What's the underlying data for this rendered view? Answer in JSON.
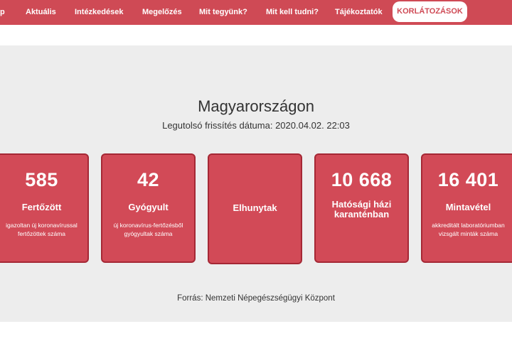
{
  "nav": {
    "items": [
      "p",
      "Aktuális",
      "Intézkedések",
      "Megelőzés",
      "Mit tegyünk?",
      "Mit kell tudni?",
      "Tájékoztatók"
    ],
    "highlight": "KORLÁTOZÁSOK"
  },
  "title": "Magyarországon",
  "updated": "Legutolsó frissítés dátuma: 2020.04.02. 22:03",
  "cards": [
    {
      "value": "585",
      "title": "Fertőzött",
      "desc": "igazoltan új koronavírussal fertőzöttek száma"
    },
    {
      "value": "42",
      "title": "Gyógyult",
      "desc": "új koronavírus-fertőzésből gyógyultak száma"
    },
    {
      "value": "",
      "title": "Elhunytak",
      "desc": ""
    },
    {
      "value": "10 668",
      "title": "Hatósági házi karanténban",
      "desc": ""
    },
    {
      "value": "16 401",
      "title": "Mintavétel",
      "desc": "akkreditált laboratóriumban vizsgált minták száma"
    }
  ],
  "source": "Forrás: Nemzeti Népegészségügyi Központ",
  "colors": {
    "accent": "#cf4a55",
    "card": "#d24a57",
    "card_border": "#a52835",
    "section_bg": "#ededed"
  }
}
